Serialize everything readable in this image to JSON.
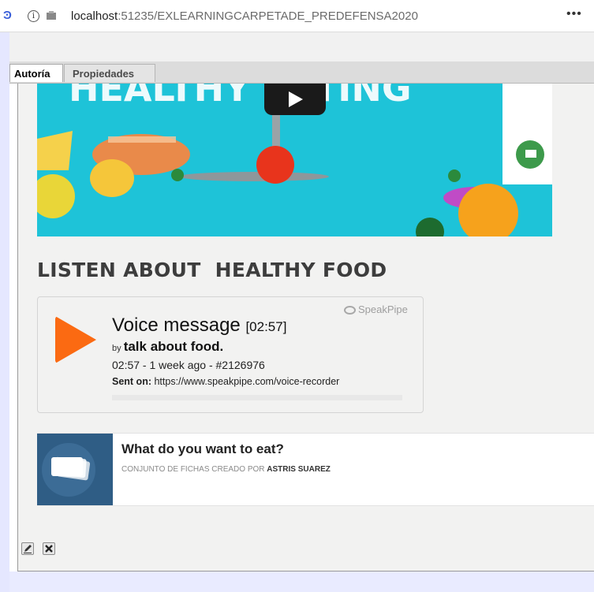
{
  "browser": {
    "url_host": "localhost",
    "url_path": ":51235/EXLEARNINGCARPETADE_PREDEFENSA2020",
    "menu_label": "•••",
    "info_label": "i"
  },
  "tabs": [
    {
      "label": "Autoría",
      "active": true
    },
    {
      "label": "Propiedades",
      "active": false
    }
  ],
  "video": {
    "title_text": "HEALTHY EATING"
  },
  "section_heading": "LISTEN ABOUT  HEALTHY FOOD",
  "voice_message": {
    "brand": "SpeakPipe",
    "title": "Voice message",
    "duration": "[02:57]",
    "by_label": "by",
    "author": "talk about food.",
    "meta": "02:57 - 1 week ago - #2126976",
    "sent_label": "Sent on:",
    "sent_url": "https://www.speakpipe.com/voice-recorder",
    "accent_color": "#fb6a12"
  },
  "flashcards": {
    "title": "What do you want to eat?",
    "subtitle_prefix": "CONJUNTO DE FICHAS CREADO POR",
    "author": "ASTRIS SUAREZ"
  },
  "actions": {
    "edit_icon": "pencil-icon",
    "delete_icon": "close-icon"
  }
}
